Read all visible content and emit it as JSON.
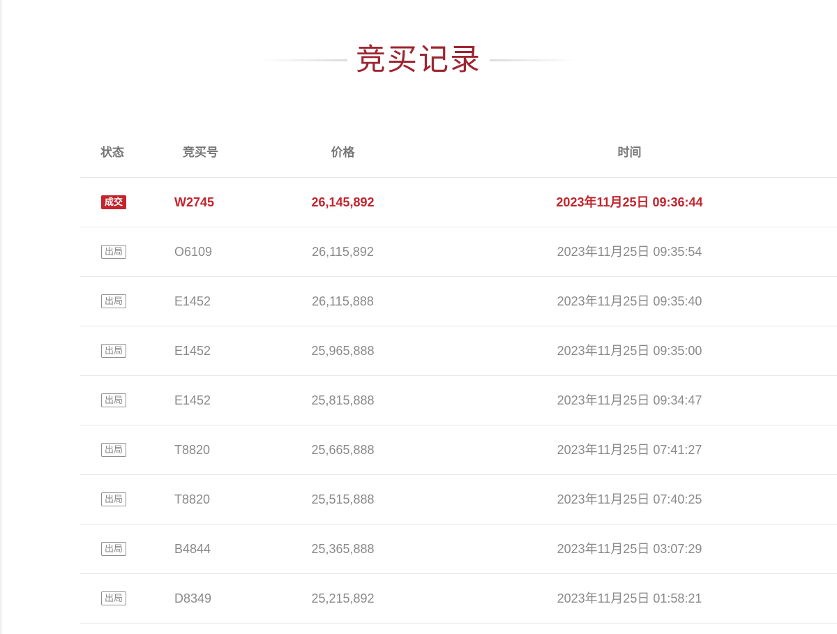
{
  "title": "竞买记录",
  "columns": {
    "status": "状态",
    "bidder": "竞买号",
    "price": "价格",
    "time": "时间"
  },
  "colors": {
    "accent": "#c3242d",
    "title": "#9e2631",
    "muted": "#8a8a8a"
  },
  "rows": [
    {
      "status": "成交",
      "bidder": "W2745",
      "price": "26,145,892",
      "time": "2023年11月25日 09:36:44",
      "won": true
    },
    {
      "status": "出局",
      "bidder": "O6109",
      "price": "26,115,892",
      "time": "2023年11月25日 09:35:54",
      "won": false
    },
    {
      "status": "出局",
      "bidder": "E1452",
      "price": "26,115,888",
      "time": "2023年11月25日 09:35:40",
      "won": false
    },
    {
      "status": "出局",
      "bidder": "E1452",
      "price": "25,965,888",
      "time": "2023年11月25日 09:35:00",
      "won": false
    },
    {
      "status": "出局",
      "bidder": "E1452",
      "price": "25,815,888",
      "time": "2023年11月25日 09:34:47",
      "won": false
    },
    {
      "status": "出局",
      "bidder": "T8820",
      "price": "25,665,888",
      "time": "2023年11月25日 07:41:27",
      "won": false
    },
    {
      "status": "出局",
      "bidder": "T8820",
      "price": "25,515,888",
      "time": "2023年11月25日 07:40:25",
      "won": false
    },
    {
      "status": "出局",
      "bidder": "B4844",
      "price": "25,365,888",
      "time": "2023年11月25日 03:07:29",
      "won": false
    },
    {
      "status": "出局",
      "bidder": "D8349",
      "price": "25,215,892",
      "time": "2023年11月25日 01:58:21",
      "won": false
    }
  ]
}
